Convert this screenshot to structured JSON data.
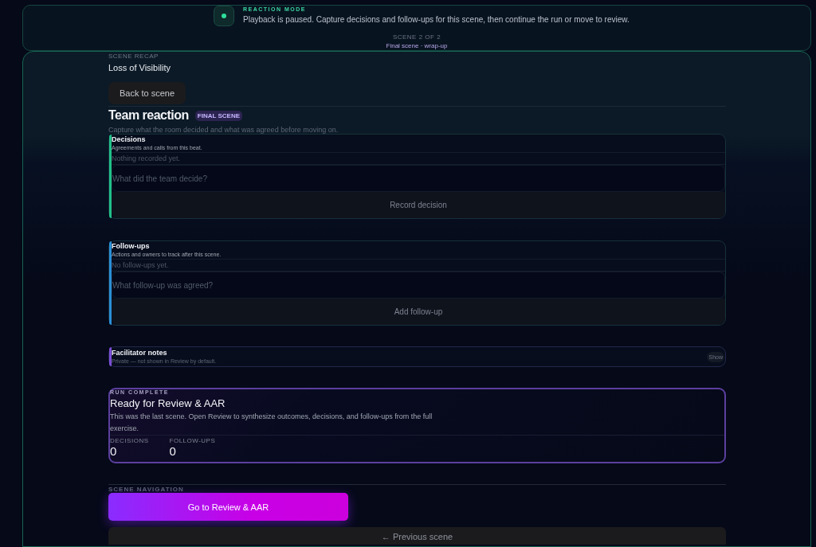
{
  "banner": {
    "eyebrow": "REACTION MODE",
    "message": "Playback is paused. Capture decisions and follow-ups for this scene, then continue the run or move to review.",
    "scene_counter": "SCENE 2 OF 2",
    "scene_name": "Final scene · wrap-up"
  },
  "recap": {
    "eyebrow": "SCENE RECAP",
    "title": "Loss of Visibility",
    "back_button": "Back to scene"
  },
  "header": {
    "title": "Team reaction",
    "badge": "FINAL SCENE",
    "caption": "Capture what the room decided and what was agreed before moving on."
  },
  "sections": [
    {
      "kind": "log",
      "title": "Decisions",
      "description": "Agreements and calls from this beat.",
      "empty": "Nothing recorded yet.",
      "placeholder": "What did the team decide?",
      "button": "Record decision",
      "color": "#22c08a"
    },
    {
      "kind": "log",
      "title": "Follow-ups",
      "description": "Actions and owners to track after this scene.",
      "empty": "No follow-ups yet.",
      "placeholder": "What follow-up was agreed?",
      "button": "Add follow-up",
      "color": "#2b8fd6"
    },
    {
      "kind": "notes",
      "title": "Facilitator notes",
      "description": "Private — not shown in Review by default.",
      "button": "Show",
      "color": "#7b4fd6"
    }
  ],
  "summary": {
    "eyebrow": "RUN COMPLETE",
    "title": "Ready for Review & AAR",
    "text": "This was the last scene. Open Review to synthesize outcomes, decisions, and follow-ups from the full exercise.",
    "stats": [
      {
        "label": "DECISIONS",
        "value": "0"
      },
      {
        "label": "FOLLOW-UPS",
        "value": "0"
      }
    ]
  },
  "navigation": {
    "eyebrow": "SCENE NAVIGATION",
    "primary_button": "Go to Review & AAR",
    "secondary_button": "← Previous scene"
  }
}
